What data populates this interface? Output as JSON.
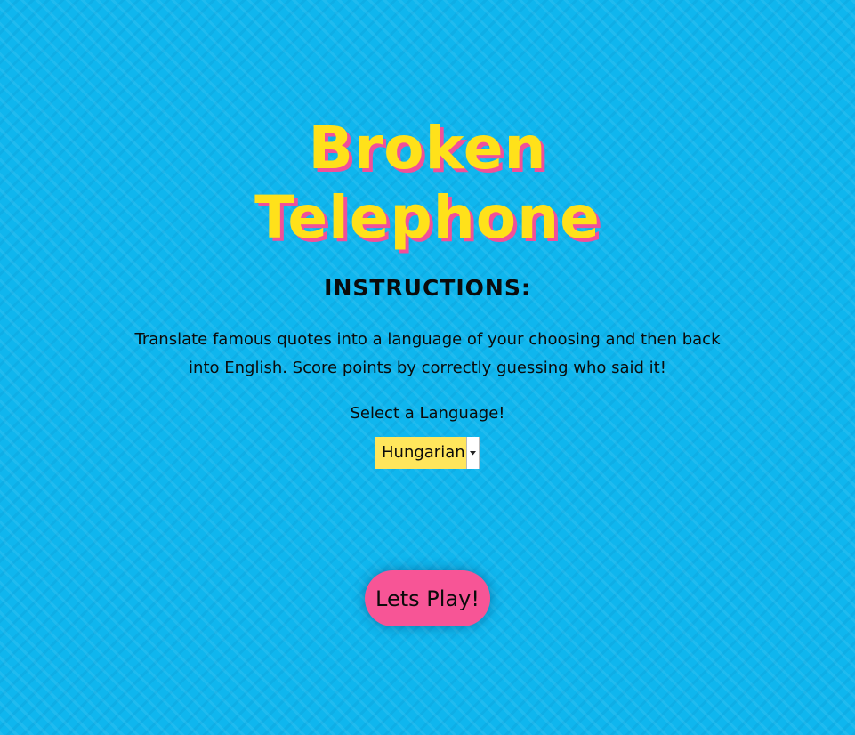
{
  "app": {
    "title_line1": "Broken",
    "title_line2": "Telephone"
  },
  "instructions": {
    "heading": "INSTRUCTIONS:",
    "body": "Translate famous quotes into a language of your choosing and then back into English. Score points by correctly guessing who said it!"
  },
  "language_select": {
    "label": "Select a Language!",
    "selected_value": "Hungarian",
    "arrow_icon": "triangle-down-icon"
  },
  "actions": {
    "play_label": "Lets Play!"
  },
  "colors": {
    "background": "#0fb6ee",
    "title": "#ffe11a",
    "title_shadow": "#f0509a",
    "select_bg": "#ffe65c",
    "button": "#f75596",
    "text": "#0b0b0b"
  }
}
